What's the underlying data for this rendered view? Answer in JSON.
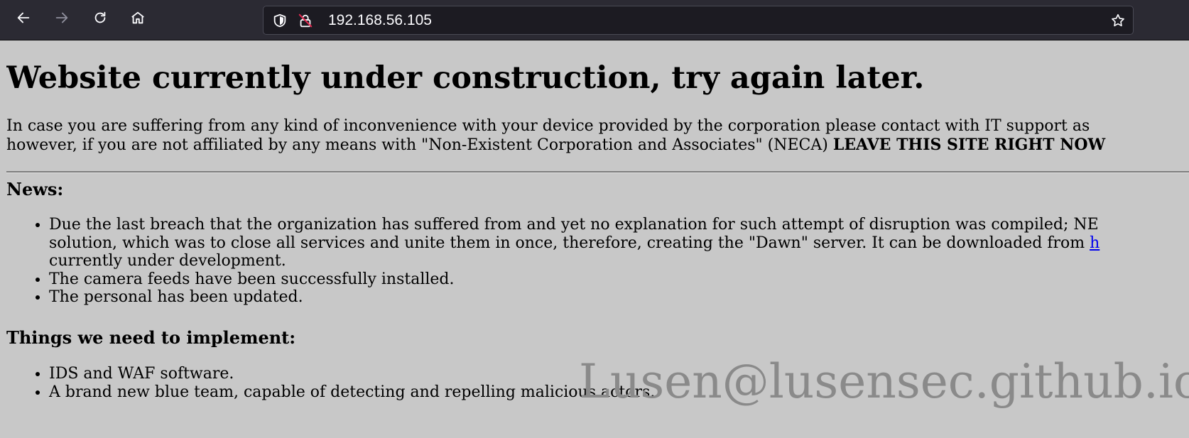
{
  "browser": {
    "back_icon": "arrow-left-icon",
    "forward_icon": "arrow-right-icon",
    "reload_icon": "reload-icon",
    "home_icon": "home-icon",
    "url": "192.168.56.105",
    "tracking_icon": "shield-icon",
    "insecure_icon": "insecure-lock-icon",
    "bookmark_icon": "star-icon"
  },
  "page": {
    "heading": "Website currently under construction, try again later.",
    "intro_line1": "In case you are suffering from any kind of inconvenience with your device provided by the corporation please contact with IT support as",
    "intro_line2_prefix": "however, if you are not affiliated by any means with \"Non-Existent Corporation and Associates\" (NECA) ",
    "intro_line2_bold": "LEAVE THIS SITE RIGHT NOW",
    "news": {
      "title": "News:",
      "item1_line1": "Due the last breach that the organization has suffered from and yet no explanation for such attempt of disruption was compiled; NE",
      "item1_line2_prefix": "solution, which was to close all services and unite them in once, therefore, creating the \"Dawn\" server. It can be downloaded from ",
      "item1_link": "h",
      "item1_line3": "currently under development.",
      "item2": "The camera feeds have been successfully installed.",
      "item3": "The personal has been updated."
    },
    "todo": {
      "title": "Things we need to implement:",
      "items": [
        "IDS and WAF software.",
        "A brand new blue team, capable of detecting and repelling malicious actors."
      ]
    }
  },
  "watermark": "Lusen@lusensec.github.io",
  "colors": {
    "page_background": "#c8c8c8",
    "toolbar_background": "#2b2a33",
    "urlbar_background": "#1c1b22",
    "link": "#0000ee",
    "watermark": "#8a8a8a"
  }
}
